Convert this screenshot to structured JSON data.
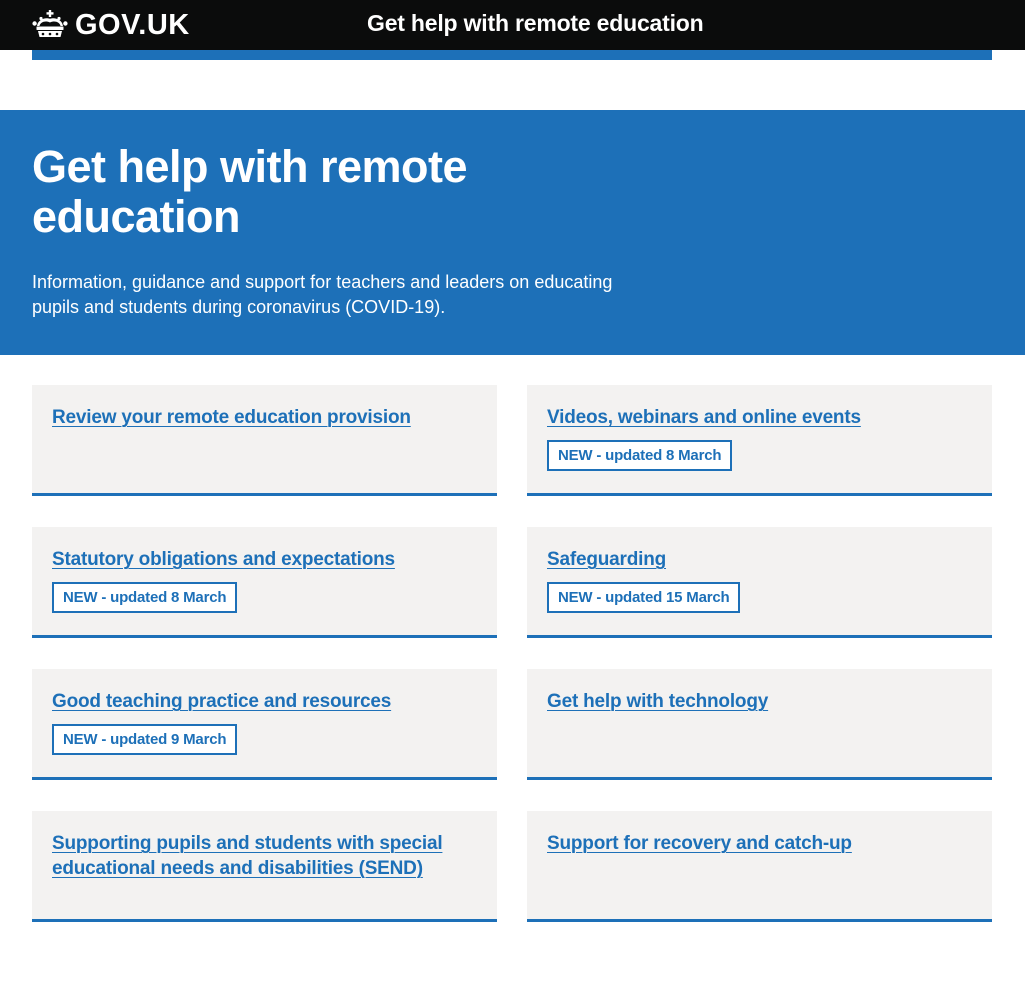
{
  "header": {
    "logo_text": "GOV.UK",
    "logo_icon": "crown-icon",
    "service_name": "Get help with remote education"
  },
  "hero": {
    "title": "Get help with remote education",
    "lead": "Information, guidance and support for teachers and leaders on educating pupils and students during coronavirus (COVID-19)."
  },
  "cards": [
    {
      "title": "Review your remote education provision",
      "tag": ""
    },
    {
      "title": "Videos, webinars and online events",
      "tag": "NEW - updated 8 March"
    },
    {
      "title": "Statutory obligations and expectations",
      "tag": "NEW - updated 8 March"
    },
    {
      "title": "Safeguarding",
      "tag": "NEW - updated 15 March"
    },
    {
      "title": "Good teaching practice and resources",
      "tag": "NEW - updated 9 March"
    },
    {
      "title": "Get help with technology",
      "tag": ""
    },
    {
      "title": "Supporting pupils and students with special educational needs and disabilities (SEND)",
      "tag": ""
    },
    {
      "title": "Support for recovery and catch-up",
      "tag": ""
    }
  ],
  "colors": {
    "header_bg": "#0b0c0c",
    "brand_blue": "#1d70b8",
    "card_bg": "#f3f2f1",
    "white": "#ffffff"
  }
}
